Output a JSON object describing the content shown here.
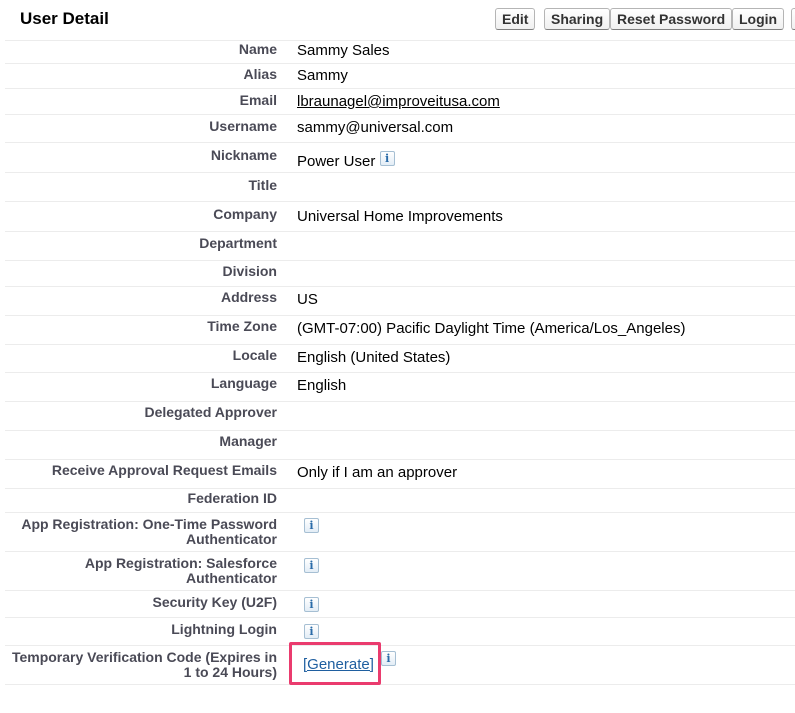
{
  "header": {
    "title": "User Detail",
    "buttons": {
      "edit": "Edit",
      "sharing": "Sharing",
      "reset_password": "Reset Password",
      "login": "Login"
    }
  },
  "fields": {
    "name": {
      "label": "Name",
      "value": "Sammy Sales"
    },
    "alias": {
      "label": "Alias",
      "value": "Sammy"
    },
    "email": {
      "label": "Email",
      "value": "lbraunagel@improveitusa.com"
    },
    "username": {
      "label": "Username",
      "value": "sammy@universal.com"
    },
    "nickname": {
      "label": "Nickname",
      "value": "Power User"
    },
    "title": {
      "label": "Title",
      "value": ""
    },
    "company": {
      "label": "Company",
      "value": "Universal Home Improvements"
    },
    "department": {
      "label": "Department",
      "value": ""
    },
    "division": {
      "label": "Division",
      "value": ""
    },
    "address": {
      "label": "Address",
      "value": "US"
    },
    "time_zone": {
      "label": "Time Zone",
      "value": "(GMT-07:00) Pacific Daylight Time (America/Los_Angeles)"
    },
    "locale": {
      "label": "Locale",
      "value": "English (United States)"
    },
    "language": {
      "label": "Language",
      "value": "English"
    },
    "delegated_approver": {
      "label": "Delegated Approver",
      "value": ""
    },
    "manager": {
      "label": "Manager",
      "value": ""
    },
    "receive_approval": {
      "label": "Receive Approval Request Emails",
      "value": "Only if I am an approver"
    },
    "federation_id": {
      "label": "Federation ID",
      "value": ""
    },
    "app_reg_otp": {
      "label_line1": "App Registration: One-Time Password",
      "label_line2": "Authenticator"
    },
    "app_reg_sf": {
      "label_line1": "App Registration: Salesforce",
      "label_line2": "Authenticator"
    },
    "security_key": {
      "label": "Security Key (U2F)"
    },
    "lightning_login": {
      "label": "Lightning Login"
    },
    "temp_code": {
      "label_line1": "Temporary Verification Code (Expires in",
      "label_line2": "1 to 24 Hours)",
      "link": "[Generate]"
    }
  },
  "info_glyph": "i",
  "icons": {
    "info": "info-icon"
  },
  "colors": {
    "highlight": "#ea3b6e",
    "link": "#1f5fa0",
    "label": "#4a4a56"
  }
}
